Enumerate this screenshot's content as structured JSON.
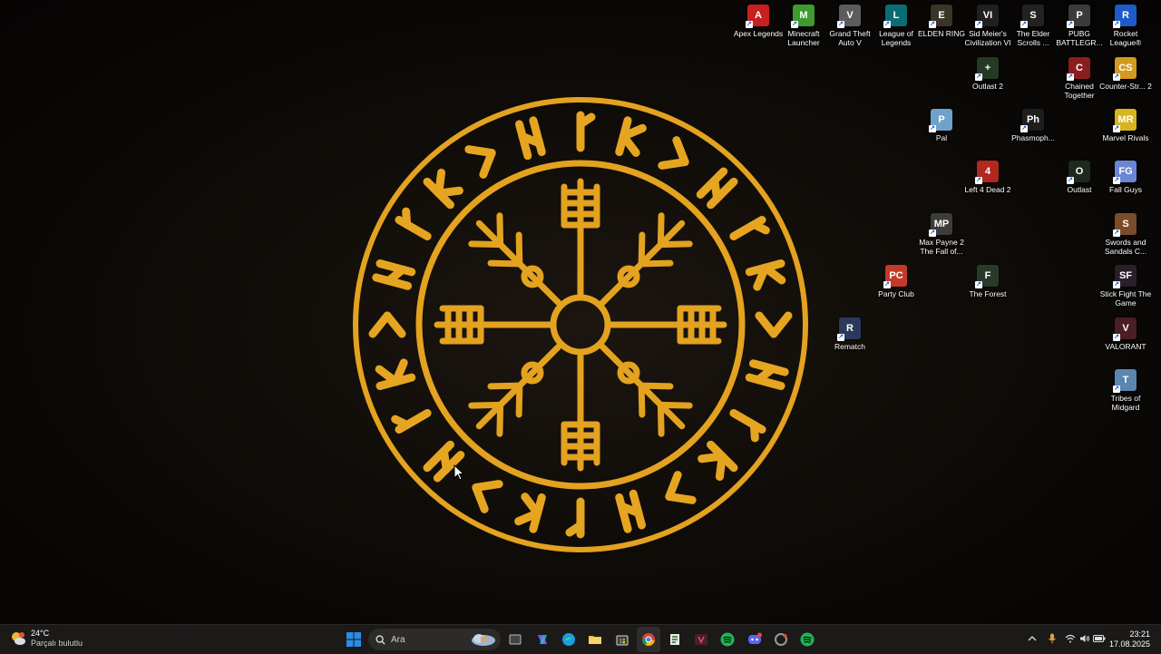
{
  "desktop_icons": [
    {
      "label": "Apex Legends",
      "color": "#c8201e",
      "glyph": "A"
    },
    {
      "label": "Minecraft Launcher",
      "color": "#3f9a2f",
      "glyph": "M"
    },
    {
      "label": "Grand Theft Auto V",
      "color": "#5c5c5c",
      "glyph": "V"
    },
    {
      "label": "League of Legends",
      "color": "#0a6c75",
      "glyph": "L"
    },
    {
      "label": "ELDEN RING",
      "color": "#3a3526",
      "glyph": "E"
    },
    {
      "label": "Sid Meier's Civilization VI",
      "color": "#202020",
      "glyph": "VI"
    },
    {
      "label": "The Elder Scrolls ...",
      "color": "#222222",
      "glyph": "S"
    },
    {
      "label": "PUBG BATTLEGR...",
      "color": "#3b3b3b",
      "glyph": "P"
    },
    {
      "label": "Rocket League®",
      "color": "#1c5bc9",
      "glyph": "R"
    },
    {
      "label": "Outlast 2",
      "color": "#243a24",
      "glyph": "+"
    },
    {
      "label": "Chained Together",
      "color": "#8a1e1e",
      "glyph": "C"
    },
    {
      "label": "Counter-Str... 2",
      "color": "#d29a1e",
      "glyph": "CS"
    },
    {
      "label": "Pal",
      "color": "#6fa2c9",
      "glyph": "P"
    },
    {
      "label": "Phasmoph...",
      "color": "#1e1e1e",
      "glyph": "Ph"
    },
    {
      "label": "Marvel Rivals",
      "color": "#d8b41e",
      "glyph": "MR"
    },
    {
      "label": "Left 4 Dead 2",
      "color": "#b0281e",
      "glyph": "4"
    },
    {
      "label": "Outlast",
      "color": "#1e2a1e",
      "glyph": "O"
    },
    {
      "label": "Fall Guys",
      "color": "#6b86d6",
      "glyph": "FG"
    },
    {
      "label": "Max Payne 2 The Fall of...",
      "color": "#3c3c3c",
      "glyph": "MP"
    },
    {
      "label": "Swords and Sandals C...",
      "color": "#7a4c2a",
      "glyph": "S"
    },
    {
      "label": "Party Club",
      "color": "#c23a2a",
      "glyph": "PC"
    },
    {
      "label": "The Forest",
      "color": "#2a3a2a",
      "glyph": "F"
    },
    {
      "label": "Stick Fight The Game",
      "color": "#2a1e2a",
      "glyph": "SF"
    },
    {
      "label": "Rematch",
      "color": "#2a3a5a",
      "glyph": "R"
    },
    {
      "label": "VALORANT",
      "color": "#4a1e24",
      "glyph": "V"
    },
    {
      "label": "Tribes of Midgard",
      "color": "#5a86b0",
      "glyph": "T"
    }
  ],
  "taskbar": {
    "weather_temp": "24°C",
    "weather_desc": "Parçalı bulutlu",
    "search_placeholder": "Ara",
    "time": "23:21",
    "date": "17.08.2025"
  },
  "accent_colors": {
    "wallpaper_gold": "#e3a21f",
    "taskbar_bg": "#1b1a19",
    "spotify": "#1db954",
    "windows_blue": "#2b8ce8"
  }
}
